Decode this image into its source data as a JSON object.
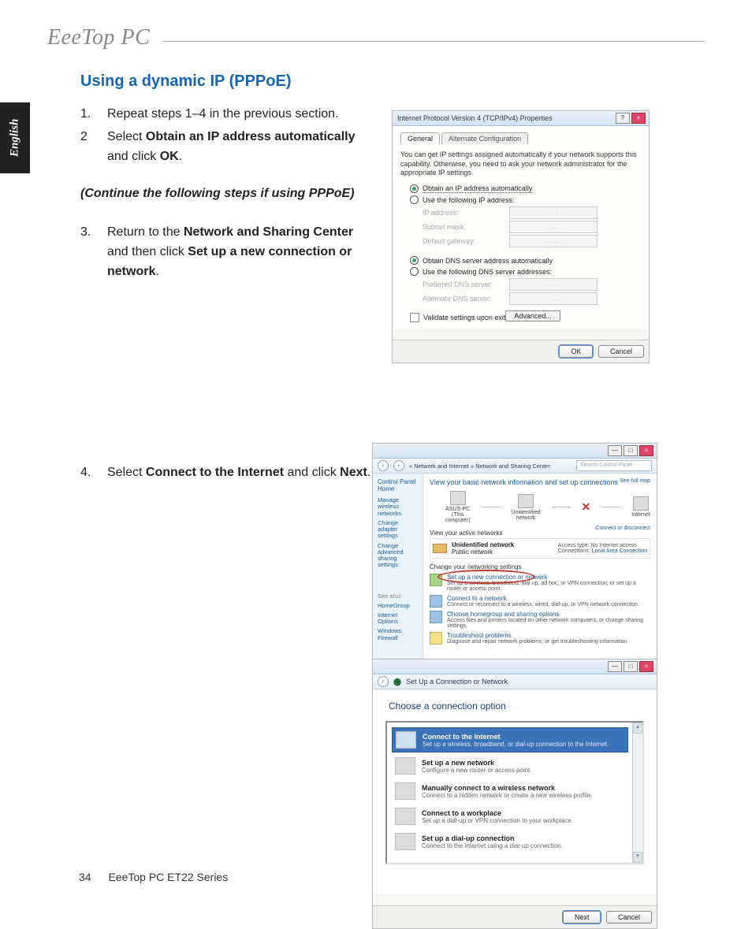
{
  "header": {
    "logo_text": "EeeTop PC"
  },
  "lang_tab": "English",
  "section_title": "Using a dynamic IP (PPPoE)",
  "steps_a": [
    {
      "num": "1.",
      "plain": "Repeat steps 1–4 in the previous section."
    },
    {
      "num": "2",
      "pre": "Select ",
      "b1": "Obtain an IP address automatically",
      "mid": " and click ",
      "b2": "OK",
      "post": "."
    }
  ],
  "continue_note": "(Continue the following steps if using PPPoE)",
  "steps_b": [
    {
      "num": "3.",
      "pre": "Return to the ",
      "b1": "Network and Sharing Center",
      "mid": " and then click ",
      "b2": "Set up a new connection or network",
      "post": "."
    },
    {
      "num": "4.",
      "pre": "Select ",
      "b1": "Connect to the Internet",
      "mid": " and click ",
      "b2": "Next",
      "post": "."
    }
  ],
  "shot1": {
    "title": "Internet Protocol Version 4 (TCP/IPv4) Properties",
    "tab_general": "General",
    "tab_alt": "Alternate Configuration",
    "info": "You can get IP settings assigned automatically if your network supports this capability. Otherwise, you need to ask your network administrator for the appropriate IP settings.",
    "r_obtain_ip": "Obtain an IP address automatically",
    "r_use_ip": "Use the following IP address:",
    "f_ip": "IP address:",
    "f_mask": "Subnet mask:",
    "f_gw": "Default gateway:",
    "r_obtain_dns": "Obtain DNS server address automatically",
    "r_use_dns": "Use the following DNS server addresses:",
    "f_pdns": "Preferred DNS server:",
    "f_adns": "Alternate DNS server:",
    "chk_validate": "Validate settings upon exit",
    "btn_adv": "Advanced...",
    "btn_ok": "OK",
    "btn_cancel": "Cancel",
    "dots": ".   .   ."
  },
  "shot2": {
    "bc_path": "« Network and Internet  »  Network and Sharing Center",
    "bc_search": "Search Control Panel",
    "side_heading": "Control Panel Home",
    "side_l1": "Manage wireless networks",
    "side_l2": "Change adapter settings",
    "side_l3": "Change advanced sharing settings",
    "sa_head": "See also",
    "sa_1": "HomeGroup",
    "sa_2": "Internet Options",
    "sa_3": "Windows Firewall",
    "main_h1": "View your basic network information and set up connections",
    "full_map": "See full map",
    "ic_pc": "ASUS-PC",
    "ic_pc_sub": "(This computer)",
    "ic_unid": "Unidentified network",
    "ic_net": "Internet",
    "view_active": "View your active networks",
    "connect_disc": "Connect or disconnect",
    "net_name": "Unidentified network",
    "net_type": "Public network",
    "acc_type_lbl": "Access type:",
    "acc_type_val": "No Internet access",
    "conn_lbl": "Connections:",
    "conn_val": "Local Area Connection",
    "change_head": "Change your networking settings",
    "c1_t": "Set up a new connection or network",
    "c1_d": "Set up a wireless, broadband, dial-up, ad hoc, or VPN connection; or set up a router or access point.",
    "c2_t": "Connect to a network",
    "c2_d": "Connect or reconnect to a wireless, wired, dial-up, or VPN network connection.",
    "c3_t": "Choose homegroup and sharing options",
    "c3_d": "Access files and printers located on other network computers, or change sharing settings.",
    "c4_t": "Troubleshoot problems",
    "c4_d": "Diagnose and repair network problems, or get troubleshooting information."
  },
  "shot3": {
    "title": "Set Up a Connection or Network",
    "h1": "Choose a connection option",
    "o1_t": "Connect to the Internet",
    "o1_d": "Set up a wireless, broadband, or dial-up connection to the Internet.",
    "o2_t": "Set up a new network",
    "o2_d": "Configure a new router or access point.",
    "o3_t": "Manually connect to a wireless network",
    "o3_d": "Connect to a hidden network or create a new wireless profile.",
    "o4_t": "Connect to a workplace",
    "o4_d": "Set up a dial-up or VPN connection to your workplace.",
    "o5_t": "Set up a dial-up connection",
    "o5_d": "Connect to the Internet using a dial-up connection.",
    "btn_next": "Next",
    "btn_cancel": "Cancel"
  },
  "footer": {
    "page": "34",
    "series": "EeeTop PC ET22 Series"
  }
}
